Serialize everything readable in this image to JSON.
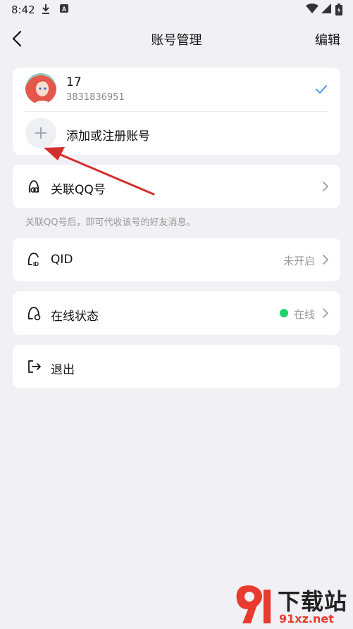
{
  "status_bar": {
    "time": "8:42"
  },
  "header": {
    "title": "账号管理",
    "edit_label": "编辑"
  },
  "account": {
    "name": "17",
    "qq_number": "3831836951"
  },
  "add_account": {
    "label": "添加或注册账号"
  },
  "link_qq": {
    "label": "关联QQ号",
    "note": "关联QQ号后，即可代收该号的好友消息。"
  },
  "qid": {
    "label": "QID",
    "value": "未开启"
  },
  "online_status": {
    "label": "在线状态",
    "value": "在线",
    "dot_color": "#1ed36a"
  },
  "logout": {
    "label": "退出"
  },
  "colors": {
    "background": "#f0f0f5",
    "accent": "#3a8ee6",
    "arrow": "#d32f2f"
  },
  "watermark": {
    "text_main": "下载站",
    "text_url": "91xz.net"
  }
}
